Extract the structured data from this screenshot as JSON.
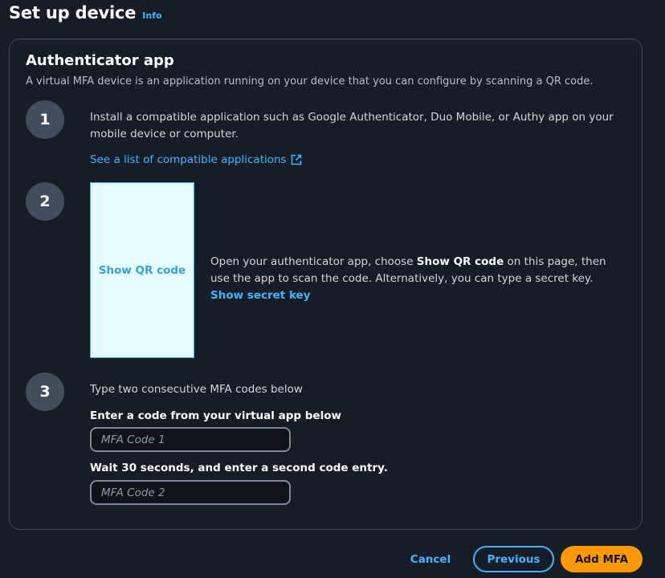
{
  "header": {
    "title": "Set up device",
    "info_link": "Info"
  },
  "panel": {
    "title": "Authenticator app",
    "description": "A virtual MFA device is an application running on your device that you can configure by scanning a QR code."
  },
  "steps": [
    {
      "number": "1",
      "text": "Install a compatible application such as Google Authenticator, Duo Mobile, or Authy app on your mobile device or computer.",
      "link": "See a list of compatible applications",
      "link_icon": "external-link-icon"
    },
    {
      "number": "2",
      "qr_button": "Show QR code",
      "text_before": "Open your authenticator app, choose ",
      "text_bold": "Show QR code",
      "text_after": " on this page, then use the app to scan the code. Alternatively, you can type a secret key. ",
      "secret_link": "Show secret key"
    },
    {
      "number": "3",
      "intro": "Type two consecutive MFA codes below",
      "field1_label": "Enter a code from your virtual app below",
      "field1_placeholder": "MFA Code 1",
      "field1_value": "",
      "field2_label": "Wait 30 seconds, and enter a second code entry.",
      "field2_placeholder": "MFA Code 2",
      "field2_value": ""
    }
  ],
  "footer": {
    "cancel": "Cancel",
    "previous": "Previous",
    "add": "Add MFA"
  },
  "colors": {
    "background": "#161d26",
    "link": "#42b4ff",
    "primary_button": "#ff9900",
    "step_circle": "#414d5c"
  }
}
